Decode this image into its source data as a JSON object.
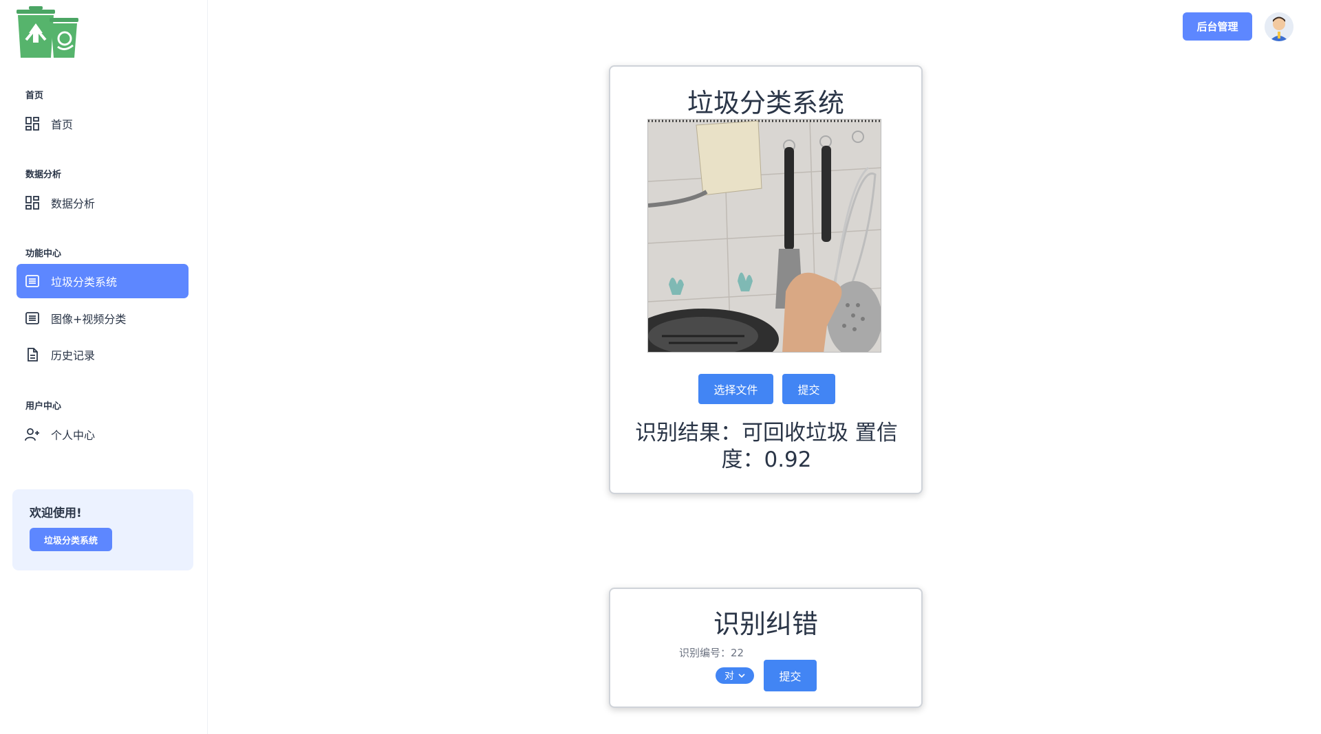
{
  "sidebar": {
    "sections": [
      {
        "label": "首页"
      },
      {
        "label": "数据分析"
      },
      {
        "label": "功能中心"
      },
      {
        "label": "用户中心"
      }
    ],
    "items": [
      {
        "label": "首页",
        "icon": "dashboard-icon"
      },
      {
        "label": "数据分析",
        "icon": "dashboard-icon"
      },
      {
        "label": "垃圾分类系统",
        "icon": "list-icon",
        "active": true
      },
      {
        "label": "图像+视频分类",
        "icon": "list-icon"
      },
      {
        "label": "历史记录",
        "icon": "file-icon"
      },
      {
        "label": "个人中心",
        "icon": "user-plus-icon"
      }
    ],
    "welcome": {
      "title": "欢迎使用!",
      "button": "垃圾分类系统"
    }
  },
  "header": {
    "admin_button": "后台管理"
  },
  "classify_card": {
    "title": "垃圾分类系统",
    "choose_file": "选择文件",
    "submit": "提交",
    "result_line1": "识别结果：可回收垃圾 置信",
    "result_line2": "度：0.92"
  },
  "correction_card": {
    "title": "识别纠错",
    "id_label": "识别编号：",
    "id_value": "22",
    "select_value": "对",
    "submit": "提交"
  },
  "colors": {
    "accent": "#5d87ff",
    "button_blue": "#4285f4",
    "welcome_bg": "#ecf2ff"
  }
}
